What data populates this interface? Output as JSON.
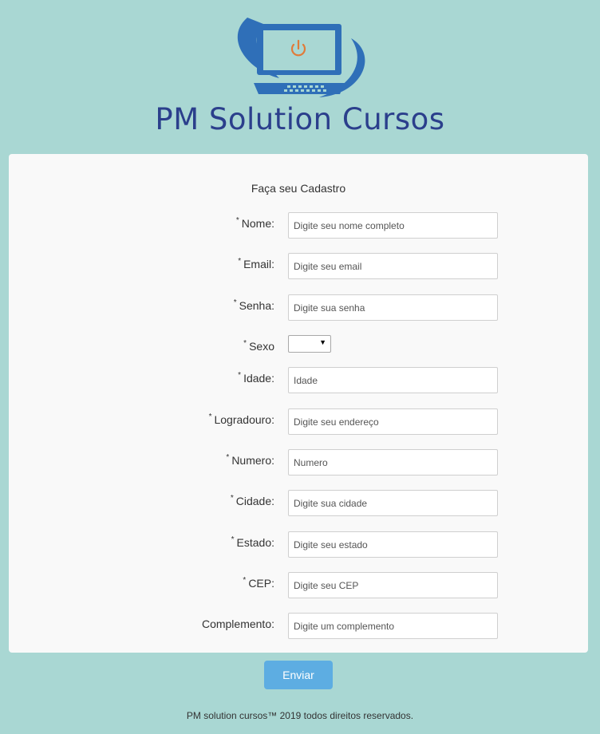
{
  "brand": {
    "name": "PM Solution Cursos"
  },
  "form": {
    "title": "Faça seu Cadastro",
    "fields": [
      {
        "required": "*",
        "label": "Nome:",
        "placeholder": "Digite seu nome completo"
      },
      {
        "required": "*",
        "label": "Email:",
        "placeholder": "Digite seu email"
      },
      {
        "required": "*",
        "label": "Senha:",
        "placeholder": "Digite sua senha"
      },
      {
        "required": "*",
        "label": "Sexo",
        "selected": ""
      },
      {
        "required": "*",
        "label": "Idade:",
        "placeholder": "Idade"
      },
      {
        "required": "*",
        "label": "Logradouro:",
        "placeholder": "Digite seu endereço"
      },
      {
        "required": "*",
        "label": "Numero:",
        "placeholder": "Numero"
      },
      {
        "required": "*",
        "label": "Cidade:",
        "placeholder": "Digite sua cidade"
      },
      {
        "required": "*",
        "label": "Estado:",
        "placeholder": "Digite seu estado"
      },
      {
        "required": "*",
        "label": "CEP:",
        "placeholder": "Digite seu CEP"
      },
      {
        "required": "",
        "label": "Complemento:",
        "placeholder": "Digite um complemento"
      }
    ],
    "submit_label": "Enviar"
  },
  "footer": {
    "text": "PM solution cursos™ 2019 todos direitos reservados."
  },
  "colors": {
    "background": "#a9d7d3",
    "button": "#5dade2",
    "brand": "#2b3f8c",
    "power_icon": "#e07b39"
  },
  "icons": {
    "logo": "computer-monitor-icon",
    "power": "power-icon",
    "select_arrow": "triangle-down-icon"
  }
}
